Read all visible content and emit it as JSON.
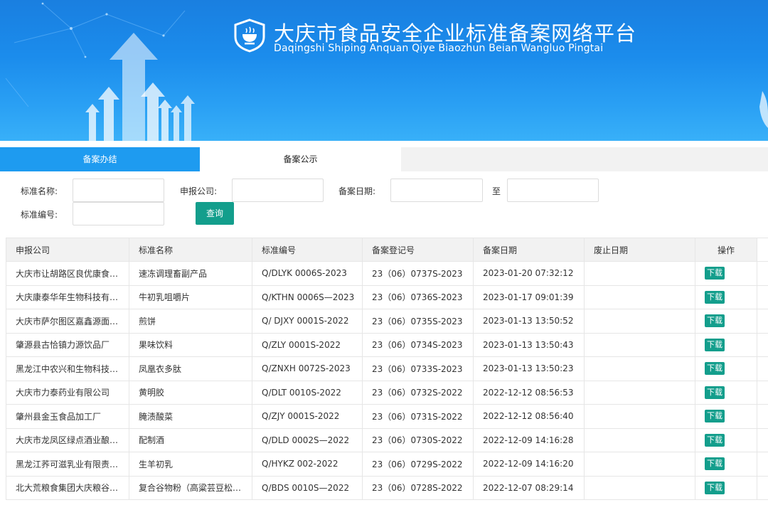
{
  "header": {
    "title_cn": "大庆市食品安全企业标准备案网络平台",
    "title_en": "Daqingshi Shiping Anquan Qiye Biaozhun Beian Wangluo Pingtai",
    "logo_icon": "shield-bowl-icon"
  },
  "tabs": [
    {
      "label": "备案办结",
      "active": true
    },
    {
      "label": "备案公示",
      "active": false
    }
  ],
  "search": {
    "std_name_label": "标准名称:",
    "company_label": "申报公司:",
    "date_label": "备案日期:",
    "to_label": "至",
    "std_no_label": "标准编号:",
    "query_button": "查询",
    "std_name_value": "",
    "company_value": "",
    "date_from_value": "",
    "date_to_value": "",
    "std_no_value": ""
  },
  "table": {
    "columns": [
      "申报公司",
      "标准名称",
      "标准编号",
      "备案登记号",
      "备案日期",
      "废止日期",
      "操作"
    ],
    "download_label": "下载",
    "rows": [
      {
        "company": "大庆市让胡路区良优康食…",
        "name": "速冻调理畜副产品",
        "std_no": "Q/DLYK 0006S-2023",
        "reg_no": "23（06）0737S-2023",
        "date": "2023-01-20 07:32:12",
        "abolish": ""
      },
      {
        "company": "大庆康泰华年生物科技有…",
        "name": "牛初乳咀嚼片",
        "std_no": "Q/KTHN 0006S—2023",
        "reg_no": "23（06）0736S-2023",
        "date": "2023-01-17 09:01:39",
        "abolish": ""
      },
      {
        "company": "大庆市萨尔图区嘉鑫源面…",
        "name": "煎饼",
        "std_no": "Q/ DJXY 0001S-2022",
        "reg_no": "23（06）0735S-2023",
        "date": "2023-01-13 13:50:52",
        "abolish": ""
      },
      {
        "company": "肇源县古恰镇力源饮品厂",
        "name": "果味饮料",
        "std_no": "Q/ZLY 0001S-2022",
        "reg_no": "23（06）0734S-2023",
        "date": "2023-01-13 13:50:43",
        "abolish": ""
      },
      {
        "company": "黑龙江中农兴和生物科技…",
        "name": "凤凰衣多肽",
        "std_no": "Q/ZNXH 0072S-2023",
        "reg_no": "23（06）0733S-2023",
        "date": "2023-01-13 13:50:23",
        "abolish": ""
      },
      {
        "company": "大庆市力泰药业有限公司",
        "name": "黄明胶",
        "std_no": "Q/DLT 0010S-2022",
        "reg_no": "23（06）0732S-2022",
        "date": "2022-12-12 08:56:53",
        "abolish": ""
      },
      {
        "company": "肇州县金玉食品加工厂",
        "name": "腌渍酸菜",
        "std_no": "Q/ZJY 0001S-2022",
        "reg_no": "23（06）0731S-2022",
        "date": "2022-12-12 08:56:40",
        "abolish": ""
      },
      {
        "company": "大庆市龙凤区绿点酒业酿…",
        "name": "配制酒",
        "std_no": "Q/DLD 0002S—2022",
        "reg_no": "23（06）0730S-2022",
        "date": "2022-12-09 14:16:28",
        "abolish": ""
      },
      {
        "company": "黑龙江荞可滋乳业有限责…",
        "name": "生羊初乳",
        "std_no": "Q/HYKZ 002-2022",
        "reg_no": "23（06）0729S-2022",
        "date": "2022-12-09 14:16:20",
        "abolish": ""
      },
      {
        "company": "北大荒粮食集团大庆粮谷…",
        "name": "复合谷物粉（高粱芸豆松…",
        "std_no": "Q/BDS 0010S—2022",
        "reg_no": "23（06）0728S-2022",
        "date": "2022-12-07 08:29:14",
        "abolish": ""
      }
    ]
  },
  "colors": {
    "banner_blue": "#1b8cec",
    "tab_active": "#1e9bf0",
    "button_green": "#139e8c"
  }
}
